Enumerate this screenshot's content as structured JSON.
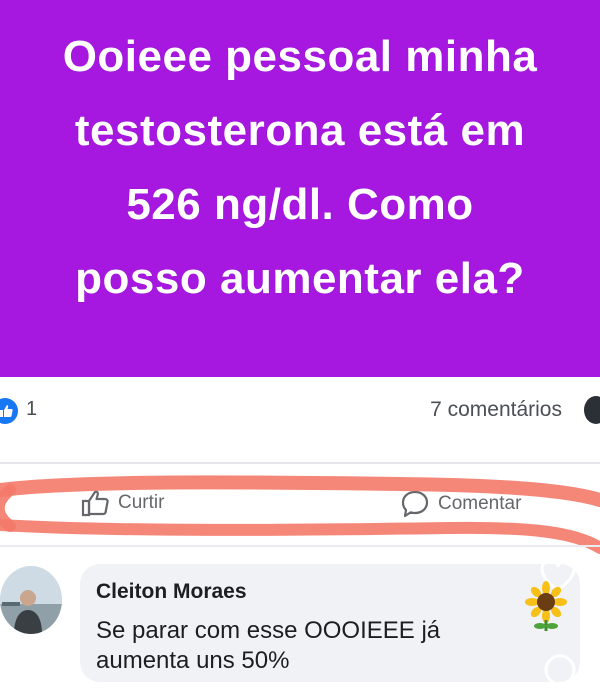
{
  "post": {
    "line1": "Ooieee pessoal minha",
    "line2": "testosterona está em",
    "line3": "526 ng/dl. Como",
    "line4": "posso aumentar ela?",
    "background_color": "#a617e0"
  },
  "reactions": {
    "like_count": "1",
    "comments_count": "7 comentários",
    "like_icon": "thumbs-up-icon",
    "world_icon": "globe-icon"
  },
  "actions": {
    "like_label": "Curtir",
    "comment_label": "Comentar",
    "like_icon": "thumbs-up-outline-icon",
    "comment_icon": "speech-bubble-icon"
  },
  "comment": {
    "author": "Cleiton Moraes",
    "text_line1": "Se parar com esse OOOIEEE já",
    "text_line2": "aumenta uns 50%",
    "sticker_icon": "sunflower-sticker-icon"
  },
  "colors": {
    "accent": "#1877f2",
    "highlight": "#f47a6a"
  }
}
